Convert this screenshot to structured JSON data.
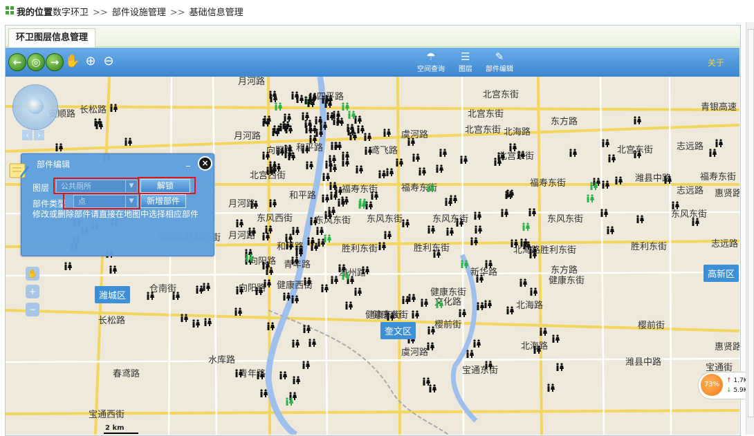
{
  "breadcrumb": {
    "prefix": "我的位置",
    "items": [
      "数字环卫",
      "部件设施管理",
      "基础信息管理"
    ],
    "separator": ">>"
  },
  "tab": {
    "label": "环卫图层信息管理"
  },
  "toolbar": {
    "tools": [
      {
        "label": "空间查询",
        "icon": "spatial-query-icon"
      },
      {
        "label": "图层",
        "icon": "layers-icon"
      },
      {
        "label": "部件编辑",
        "icon": "component-edit-icon"
      }
    ],
    "about_label": "关于"
  },
  "edit_panel": {
    "title": "部件编辑",
    "layer_label": "图层",
    "layer_value": "公共厕所",
    "unlock_button": "解锁",
    "type_label": "部件类型",
    "type_value": "点",
    "add_button": "新增部件",
    "hint": "修改或删除部件请直接在地图中选择相应部件"
  },
  "districts": [
    "潍城区",
    "奎文区",
    "高新区"
  ],
  "map_labels": [
    "月河路",
    "四平路",
    "北宫东街",
    "青银高速",
    "安顺路",
    "长松路",
    "北宫东街",
    "东方路",
    "月河路",
    "虞河路",
    "北海路",
    "向阳路",
    "和平路",
    "鸢飞路",
    "北宫东街",
    "北宫东街",
    "北宫东街",
    "志远路",
    "北宫西街",
    "福寿东街",
    "福寿东街",
    "福寿东街",
    "潍县中路",
    "志远路",
    "惠贤路",
    "和平路",
    "福寿东街",
    "月河路",
    "东风西街",
    "东风东街",
    "东风东街",
    "东风东街",
    "东风东街",
    "东风东街",
    "安顺路胜利西街",
    "月河路",
    "和平路",
    "胜利东街",
    "胜利东街",
    "北海路胜利东街",
    "胜利东街",
    "志远路",
    "健康东街",
    "向阳路",
    "青年路",
    "潍州路",
    "新华路",
    "东方路",
    "健康东街",
    "向阳路",
    "健康西街",
    "健康东街",
    "仓南街",
    "文化路",
    "北海路",
    "健康东街",
    "樱前街",
    "樱前街",
    "长松路",
    "北海路",
    "惠贤路",
    "水库路",
    "虞河路",
    "潍县中路",
    "春鸢路",
    "青年路",
    "宝通东街",
    "宝通街",
    "宝通西街"
  ],
  "scale_text": "2 km",
  "net_widget": {
    "percent": "73%",
    "up": "1.7K/s",
    "down": "5.9K/s"
  }
}
